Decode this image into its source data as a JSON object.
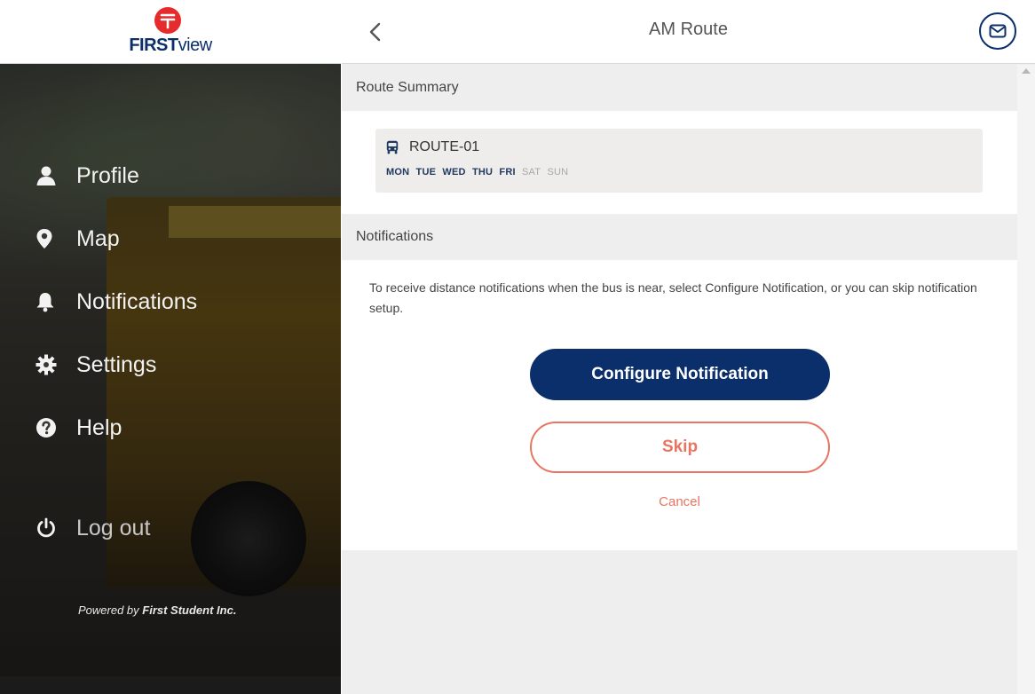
{
  "brand": {
    "logo_bold": "FIRST",
    "logo_light": "view",
    "accent": "#0b2f6b",
    "logo_red": "#e52b2b"
  },
  "sidebar": {
    "items": [
      {
        "label": "Profile",
        "icon": "user-icon"
      },
      {
        "label": "Map",
        "icon": "map-pin-icon"
      },
      {
        "label": "Notifications",
        "icon": "bell-icon"
      },
      {
        "label": "Settings",
        "icon": "gear-icon"
      },
      {
        "label": "Help",
        "icon": "question-circle-icon"
      }
    ],
    "logout": {
      "label": "Log out",
      "icon": "power-icon"
    },
    "powered_prefix": "Powered by ",
    "powered_company": "First Student Inc."
  },
  "header": {
    "title": "AM Route",
    "back_icon": "chevron-left-icon",
    "mail_icon": "envelope-icon"
  },
  "route_summary": {
    "heading": "Route Summary",
    "route_name": "ROUTE-01",
    "route_icon": "bus-icon",
    "days_active": [
      "MON",
      "TUE",
      "WED",
      "THU",
      "FRI"
    ],
    "days_inactive": [
      "SAT",
      "SUN"
    ]
  },
  "notifications": {
    "heading": "Notifications",
    "description": "To receive distance notifications when the bus is near, select Configure Notification, or you can skip notification setup.",
    "configure_label": "Configure Notification",
    "skip_label": "Skip",
    "cancel_label": "Cancel",
    "skip_color": "#e87561"
  }
}
